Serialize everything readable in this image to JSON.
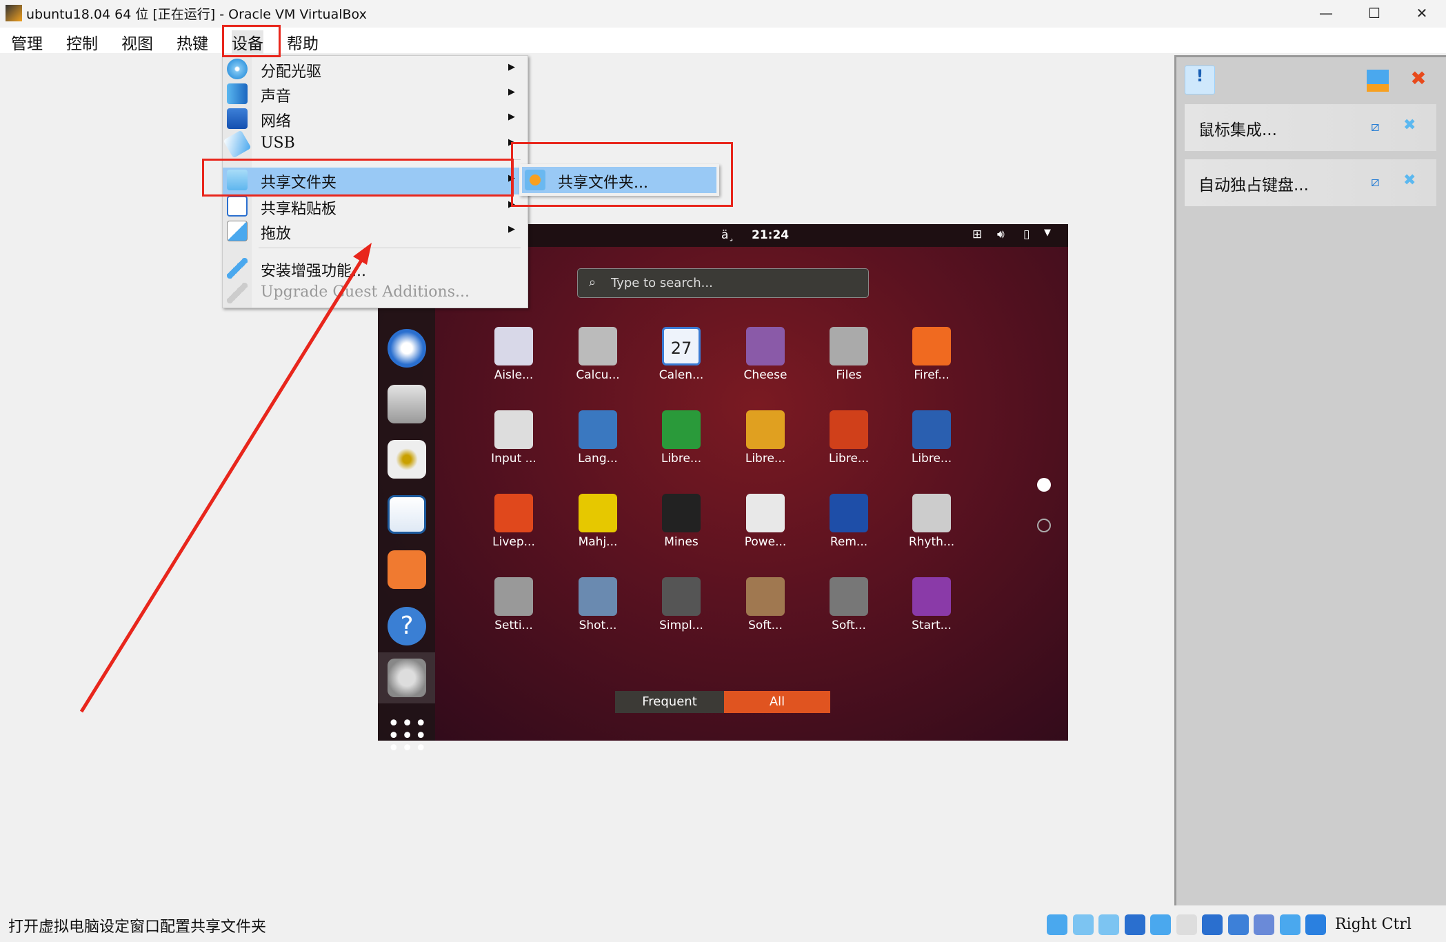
{
  "window": {
    "title": "ubuntu18.04 64 位 [正在运行] - Oracle VM VirtualBox",
    "minimize": "—",
    "maximize": "☐",
    "close": "✕"
  },
  "menubar": [
    "管理",
    "控制",
    "视图",
    "热键",
    "设备",
    "帮助"
  ],
  "devices_menu": {
    "items": [
      {
        "label": "分配光驱",
        "icon": "optical-disc-icon",
        "submenu": true
      },
      {
        "label": "声音",
        "icon": "audio-icon",
        "submenu": true
      },
      {
        "label": "网络",
        "icon": "network-icon",
        "submenu": true
      },
      {
        "label": "USB",
        "icon": "usb-icon",
        "submenu": true
      },
      {
        "label": "共享文件夹",
        "icon": "shared-folder-icon",
        "submenu": true,
        "highlighted": true
      },
      {
        "label": "共享粘贴板",
        "icon": "clipboard-icon",
        "submenu": true
      },
      {
        "label": "拖放",
        "icon": "drag-drop-icon",
        "submenu": true
      },
      {
        "label": "安装增强功能...",
        "icon": "install-additions-icon"
      },
      {
        "label": "Upgrade Guest Additions...",
        "icon": "upgrade-additions-icon",
        "disabled": true
      }
    ],
    "submenu": {
      "label": "共享文件夹...",
      "icon": "shared-folder-settings-icon"
    }
  },
  "guest": {
    "topbar": {
      "input": "ä¸",
      "time": "21:24"
    },
    "search_placeholder": "Type to search...",
    "apps": [
      [
        "Aisle...",
        "Calcu...",
        "Calen...",
        "Cheese",
        "Files",
        "Firef..."
      ],
      [
        "Input ...",
        "Lang...",
        "Libre...",
        "Libre...",
        "Libre...",
        "Libre..."
      ],
      [
        "Livep...",
        "Mahj...",
        "Mines",
        "Powe...",
        "Rem...",
        "Rhyth..."
      ],
      [
        "Setti...",
        "Shot...",
        "Simpl...",
        "Soft...",
        "Soft...",
        "Start..."
      ]
    ],
    "tabs": {
      "frequent": "Frequent",
      "all": "All",
      "active": "All"
    },
    "page": 1,
    "pages": 2,
    "calendar_day": "27",
    "dock": [
      "thunderbird",
      "files",
      "rhythmbox",
      "writer",
      "software",
      "help",
      "settings",
      "show-apps"
    ]
  },
  "notifications": {
    "items": [
      "鼠标集成...",
      "自动独占键盘..."
    ]
  },
  "statusbar": {
    "text": "打开虚拟电脑设定窗口配置共享文件夹",
    "host_key": "Right Ctrl"
  },
  "colors": {
    "highlight": "#99c9f5",
    "annotation": "#e8261c",
    "ubuntu_orange": "#e05420"
  }
}
